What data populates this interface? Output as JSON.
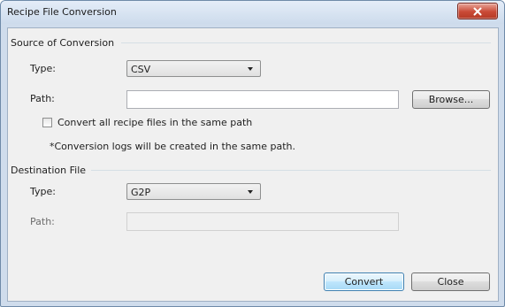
{
  "window": {
    "title": "Recipe File Conversion"
  },
  "source": {
    "group_label": "Source of Conversion",
    "type_label": "Type:",
    "type_value": "CSV",
    "path_label": "Path:",
    "path_value": "",
    "browse_label": "Browse...",
    "convert_all_label": "Convert all recipe files in the same path",
    "convert_all_checked": false,
    "note": "*Conversion logs will be created in the same path."
  },
  "destination": {
    "group_label": "Destination File",
    "type_label": "Type:",
    "type_value": "G2P",
    "path_label": "Path:",
    "path_value": ""
  },
  "footer": {
    "convert_label": "Convert",
    "close_label": "Close"
  },
  "icons": {
    "close": "close-icon",
    "dropdown": "chevron-down-icon"
  },
  "colors": {
    "close_button": "#c94a36",
    "default_button_border": "#3c7fb1"
  }
}
